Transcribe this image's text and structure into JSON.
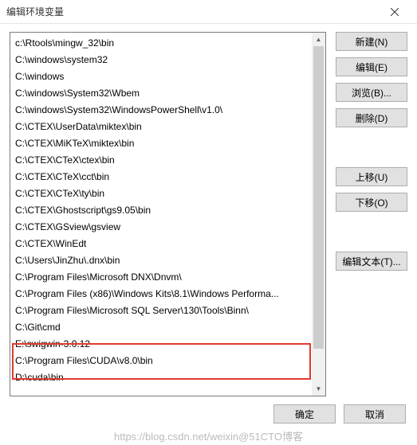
{
  "dialog": {
    "title": "编辑环境变量"
  },
  "list": {
    "items": [
      "c:\\Rtools\\mingw_32\\bin",
      "C:\\windows\\system32",
      "C:\\windows",
      "C:\\windows\\System32\\Wbem",
      "C:\\windows\\System32\\WindowsPowerShell\\v1.0\\",
      "C:\\CTEX\\UserData\\miktex\\bin",
      "C:\\CTEX\\MiKTeX\\miktex\\bin",
      "C:\\CTEX\\CTeX\\ctex\\bin",
      "C:\\CTEX\\CTeX\\cct\\bin",
      "C:\\CTEX\\CTeX\\ty\\bin",
      "C:\\CTEX\\Ghostscript\\gs9.05\\bin",
      "C:\\CTEX\\GSview\\gsview",
      "C:\\CTEX\\WinEdt",
      "C:\\Users\\JinZhu\\.dnx\\bin",
      "C:\\Program Files\\Microsoft DNX\\Dnvm\\",
      "C:\\Program Files (x86)\\Windows Kits\\8.1\\Windows Performa...",
      "C:\\Program Files\\Microsoft SQL Server\\130\\Tools\\Binn\\",
      "C:\\Git\\cmd",
      "E:\\swigwin-3.0.12",
      "C:\\Program Files\\CUDA\\v8.0\\bin",
      "D:\\cuda\\bin"
    ]
  },
  "buttons": {
    "new": "新建(N)",
    "edit": "编辑(E)",
    "browse": "浏览(B)...",
    "delete": "删除(D)",
    "moveup": "上移(U)",
    "movedown": "下移(O)",
    "edittext": "编辑文本(T)...",
    "ok": "确定",
    "cancel": "取消"
  },
  "watermark": "https://blog.csdn.net/weixin@51CTO博客"
}
